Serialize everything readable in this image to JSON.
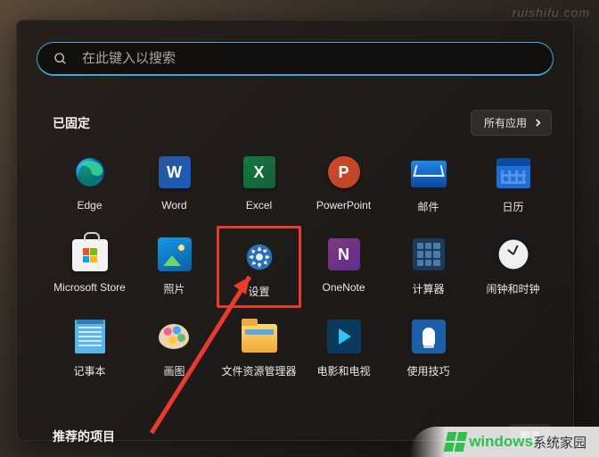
{
  "search": {
    "placeholder": "在此键入以搜索"
  },
  "sections": {
    "pinned_title": "已固定",
    "all_apps_label": "所有应用",
    "recommended_title": "推荐的项目",
    "more_label": "更多"
  },
  "apps": {
    "edge": {
      "label": "Edge"
    },
    "word": {
      "label": "Word",
      "glyph": "W"
    },
    "excel": {
      "label": "Excel",
      "glyph": "X"
    },
    "powerpoint": {
      "label": "PowerPoint",
      "glyph": "P"
    },
    "mail": {
      "label": "邮件"
    },
    "calendar": {
      "label": "日历"
    },
    "store": {
      "label": "Microsoft Store"
    },
    "photos": {
      "label": "照片"
    },
    "settings": {
      "label": "设置"
    },
    "onenote": {
      "label": "OneNote",
      "glyph": "N"
    },
    "calculator": {
      "label": "计算器"
    },
    "clock": {
      "label": "闹钟和时钟"
    },
    "notepad": {
      "label": "记事本"
    },
    "paint": {
      "label": "画图"
    },
    "explorer": {
      "label": "文件资源管理器"
    },
    "movies": {
      "label": "电影和电视"
    },
    "tips": {
      "label": "使用技巧"
    }
  },
  "highlight": {
    "target": "settings",
    "color": "#e83b2e"
  },
  "watermark": {
    "top": "ruishifu.com",
    "brand_en": "windows",
    "brand_cn": "系统家园"
  }
}
